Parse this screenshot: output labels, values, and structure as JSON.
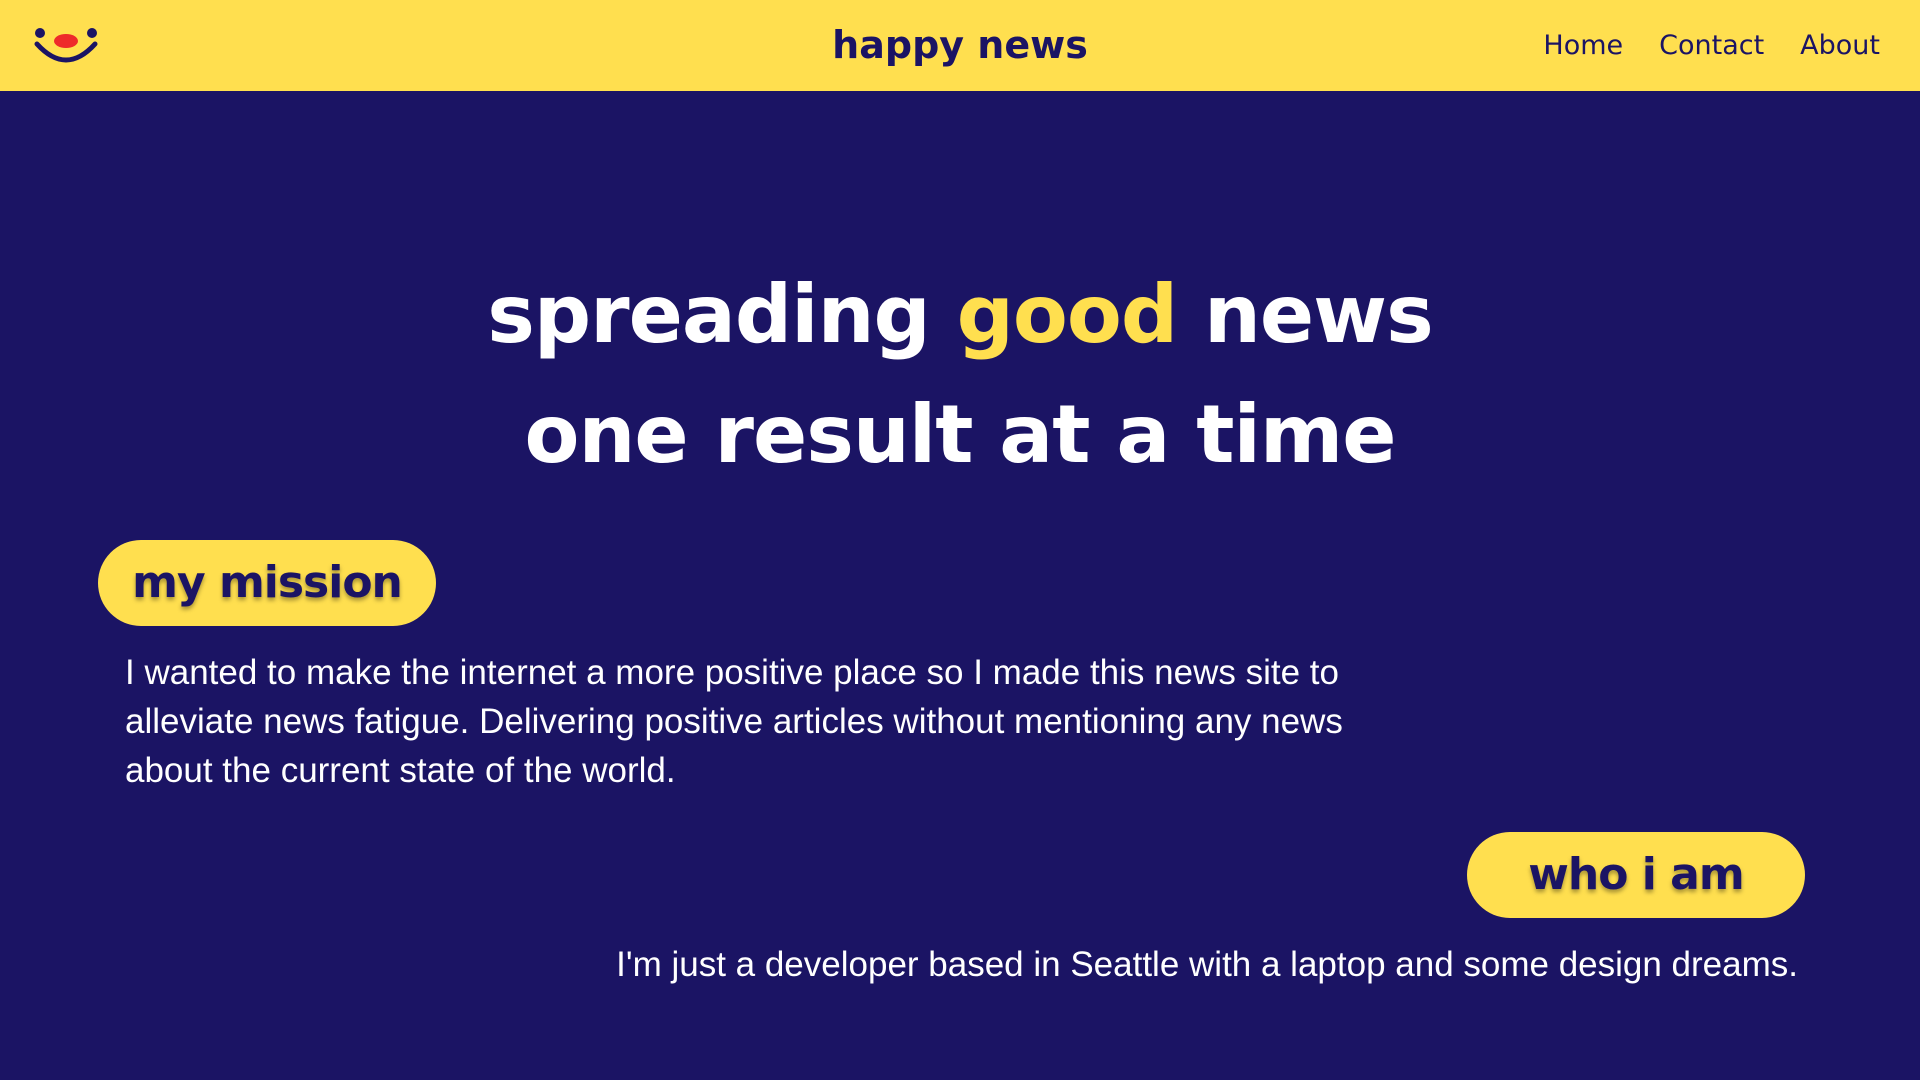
{
  "header": {
    "title": "happy news",
    "nav": [
      {
        "label": "Home"
      },
      {
        "label": "Contact"
      },
      {
        "label": "About"
      }
    ]
  },
  "hero": {
    "line1_before": "spreading ",
    "line1_accent": "good",
    "line1_after": " news",
    "line2": "one result at a time"
  },
  "mission": {
    "heading": "my mission",
    "text": "I wanted to make the internet a more positive place so I made this news site to alleviate news fatigue. Delivering positive articles without mentioning any news about the current state of the world."
  },
  "who": {
    "heading": "who i am",
    "text": "I'm just a developer based in Seattle with a laptop and some design dreams."
  },
  "colors": {
    "background": "#1b1464",
    "accent": "#ffdf4f",
    "logo_nose": "#ee2a2a"
  },
  "icons": {
    "logo": "smiley-face-icon"
  }
}
